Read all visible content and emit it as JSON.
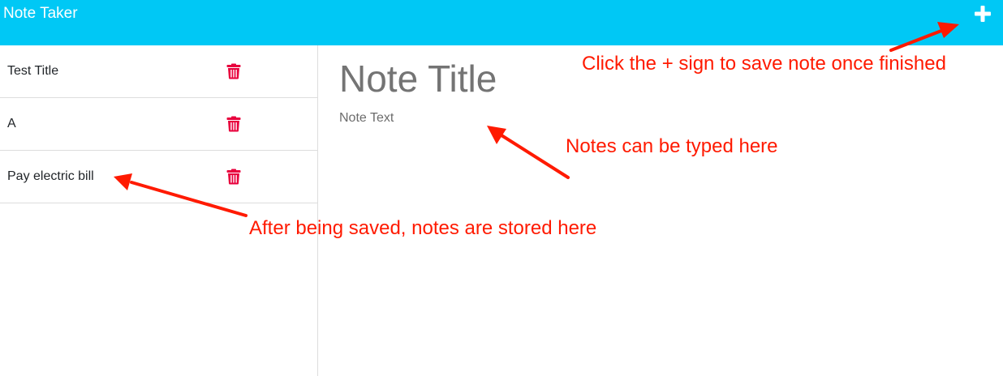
{
  "navbar": {
    "title": "Note Taker",
    "save_icon": "plus-icon"
  },
  "notes": [
    {
      "title": "Test Title",
      "delete_icon": "trash-icon"
    },
    {
      "title": "A",
      "delete_icon": "trash-icon"
    },
    {
      "title": "Pay electric bill",
      "delete_icon": "trash-icon"
    }
  ],
  "editor": {
    "title_placeholder": "Note Title",
    "text_placeholder": "Note Text"
  },
  "annotations": {
    "save": "Click the + sign to save note once finished",
    "type": "Notes can be typed here",
    "stored": "After being saved, notes are stored here"
  },
  "colors": {
    "navbar": "#00c8f5",
    "delete_icon": "#e8003d",
    "annotation": "#ff1a00"
  }
}
